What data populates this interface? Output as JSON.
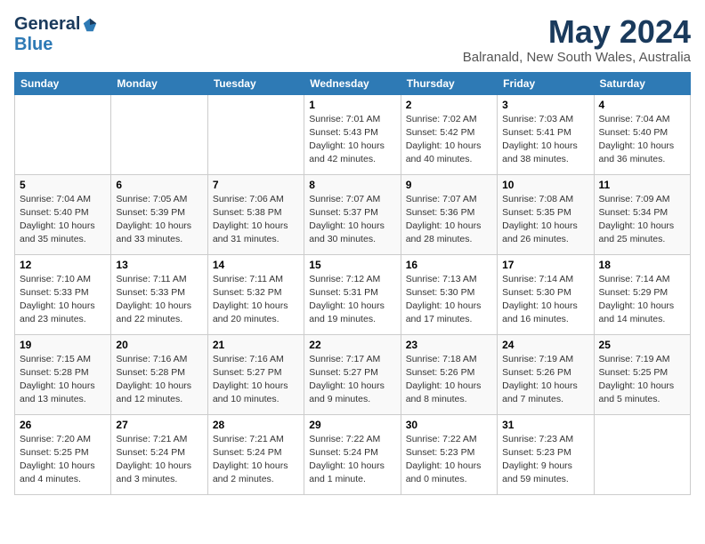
{
  "logo": {
    "general": "General",
    "blue": "Blue"
  },
  "title": "May 2024",
  "location": "Balranald, New South Wales, Australia",
  "weekdays": [
    "Sunday",
    "Monday",
    "Tuesday",
    "Wednesday",
    "Thursday",
    "Friday",
    "Saturday"
  ],
  "weeks": [
    [
      {
        "day": "",
        "info": ""
      },
      {
        "day": "",
        "info": ""
      },
      {
        "day": "",
        "info": ""
      },
      {
        "day": "1",
        "info": "Sunrise: 7:01 AM\nSunset: 5:43 PM\nDaylight: 10 hours\nand 42 minutes."
      },
      {
        "day": "2",
        "info": "Sunrise: 7:02 AM\nSunset: 5:42 PM\nDaylight: 10 hours\nand 40 minutes."
      },
      {
        "day": "3",
        "info": "Sunrise: 7:03 AM\nSunset: 5:41 PM\nDaylight: 10 hours\nand 38 minutes."
      },
      {
        "day": "4",
        "info": "Sunrise: 7:04 AM\nSunset: 5:40 PM\nDaylight: 10 hours\nand 36 minutes."
      }
    ],
    [
      {
        "day": "5",
        "info": "Sunrise: 7:04 AM\nSunset: 5:40 PM\nDaylight: 10 hours\nand 35 minutes."
      },
      {
        "day": "6",
        "info": "Sunrise: 7:05 AM\nSunset: 5:39 PM\nDaylight: 10 hours\nand 33 minutes."
      },
      {
        "day": "7",
        "info": "Sunrise: 7:06 AM\nSunset: 5:38 PM\nDaylight: 10 hours\nand 31 minutes."
      },
      {
        "day": "8",
        "info": "Sunrise: 7:07 AM\nSunset: 5:37 PM\nDaylight: 10 hours\nand 30 minutes."
      },
      {
        "day": "9",
        "info": "Sunrise: 7:07 AM\nSunset: 5:36 PM\nDaylight: 10 hours\nand 28 minutes."
      },
      {
        "day": "10",
        "info": "Sunrise: 7:08 AM\nSunset: 5:35 PM\nDaylight: 10 hours\nand 26 minutes."
      },
      {
        "day": "11",
        "info": "Sunrise: 7:09 AM\nSunset: 5:34 PM\nDaylight: 10 hours\nand 25 minutes."
      }
    ],
    [
      {
        "day": "12",
        "info": "Sunrise: 7:10 AM\nSunset: 5:33 PM\nDaylight: 10 hours\nand 23 minutes."
      },
      {
        "day": "13",
        "info": "Sunrise: 7:11 AM\nSunset: 5:33 PM\nDaylight: 10 hours\nand 22 minutes."
      },
      {
        "day": "14",
        "info": "Sunrise: 7:11 AM\nSunset: 5:32 PM\nDaylight: 10 hours\nand 20 minutes."
      },
      {
        "day": "15",
        "info": "Sunrise: 7:12 AM\nSunset: 5:31 PM\nDaylight: 10 hours\nand 19 minutes."
      },
      {
        "day": "16",
        "info": "Sunrise: 7:13 AM\nSunset: 5:30 PM\nDaylight: 10 hours\nand 17 minutes."
      },
      {
        "day": "17",
        "info": "Sunrise: 7:14 AM\nSunset: 5:30 PM\nDaylight: 10 hours\nand 16 minutes."
      },
      {
        "day": "18",
        "info": "Sunrise: 7:14 AM\nSunset: 5:29 PM\nDaylight: 10 hours\nand 14 minutes."
      }
    ],
    [
      {
        "day": "19",
        "info": "Sunrise: 7:15 AM\nSunset: 5:28 PM\nDaylight: 10 hours\nand 13 minutes."
      },
      {
        "day": "20",
        "info": "Sunrise: 7:16 AM\nSunset: 5:28 PM\nDaylight: 10 hours\nand 12 minutes."
      },
      {
        "day": "21",
        "info": "Sunrise: 7:16 AM\nSunset: 5:27 PM\nDaylight: 10 hours\nand 10 minutes."
      },
      {
        "day": "22",
        "info": "Sunrise: 7:17 AM\nSunset: 5:27 PM\nDaylight: 10 hours\nand 9 minutes."
      },
      {
        "day": "23",
        "info": "Sunrise: 7:18 AM\nSunset: 5:26 PM\nDaylight: 10 hours\nand 8 minutes."
      },
      {
        "day": "24",
        "info": "Sunrise: 7:19 AM\nSunset: 5:26 PM\nDaylight: 10 hours\nand 7 minutes."
      },
      {
        "day": "25",
        "info": "Sunrise: 7:19 AM\nSunset: 5:25 PM\nDaylight: 10 hours\nand 5 minutes."
      }
    ],
    [
      {
        "day": "26",
        "info": "Sunrise: 7:20 AM\nSunset: 5:25 PM\nDaylight: 10 hours\nand 4 minutes."
      },
      {
        "day": "27",
        "info": "Sunrise: 7:21 AM\nSunset: 5:24 PM\nDaylight: 10 hours\nand 3 minutes."
      },
      {
        "day": "28",
        "info": "Sunrise: 7:21 AM\nSunset: 5:24 PM\nDaylight: 10 hours\nand 2 minutes."
      },
      {
        "day": "29",
        "info": "Sunrise: 7:22 AM\nSunset: 5:24 PM\nDaylight: 10 hours\nand 1 minute."
      },
      {
        "day": "30",
        "info": "Sunrise: 7:22 AM\nSunset: 5:23 PM\nDaylight: 10 hours\nand 0 minutes."
      },
      {
        "day": "31",
        "info": "Sunrise: 7:23 AM\nSunset: 5:23 PM\nDaylight: 9 hours\nand 59 minutes."
      },
      {
        "day": "",
        "info": ""
      }
    ]
  ]
}
